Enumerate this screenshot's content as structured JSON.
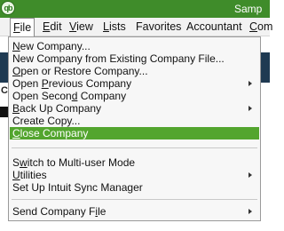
{
  "window": {
    "title": "Samp"
  },
  "menubar": {
    "items": [
      {
        "label": "File",
        "underline": "F",
        "active": true
      },
      {
        "label": "Edit",
        "underline": "E"
      },
      {
        "label": "View",
        "underline": "V"
      },
      {
        "label": "Lists",
        "underline": "L"
      },
      {
        "label": "Favorites",
        "underline": ""
      },
      {
        "label": "Accountant",
        "underline": ""
      },
      {
        "label": "Com",
        "underline": "C"
      }
    ]
  },
  "background": {
    "letter": "C"
  },
  "file_menu": {
    "items": [
      {
        "label": "New Company...",
        "underline": "N",
        "submenu": false
      },
      {
        "label": "New Company from Existing Company File...",
        "underline": "",
        "submenu": false
      },
      {
        "label": "Open or Restore Company...",
        "underline": "O",
        "submenu": false
      },
      {
        "label": "Open Previous Company",
        "underline": "P",
        "submenu": true
      },
      {
        "label": "Open Second Company",
        "underline": "d",
        "submenu": false
      },
      {
        "label": "Back Up Company",
        "underline": "B",
        "submenu": true
      },
      {
        "label": "Create Copy...",
        "underline": "",
        "submenu": false
      },
      {
        "label": "Close Company",
        "underline": "C",
        "submenu": false,
        "highlighted": true
      },
      {
        "separator": true
      },
      {
        "label": "Switch to Multi-user Mode",
        "underline": "w",
        "submenu": false
      },
      {
        "label": "Utilities",
        "underline": "U",
        "submenu": true
      },
      {
        "label": "Set Up Intuit Sync Manager",
        "underline": "",
        "submenu": false
      },
      {
        "separator": true
      },
      {
        "label": "Send Company File",
        "underline": "i",
        "submenu": true
      }
    ]
  },
  "colors": {
    "titlebar": "#3f8c2a",
    "highlight": "#53a52e",
    "menu_bg": "#f7f7f7"
  }
}
